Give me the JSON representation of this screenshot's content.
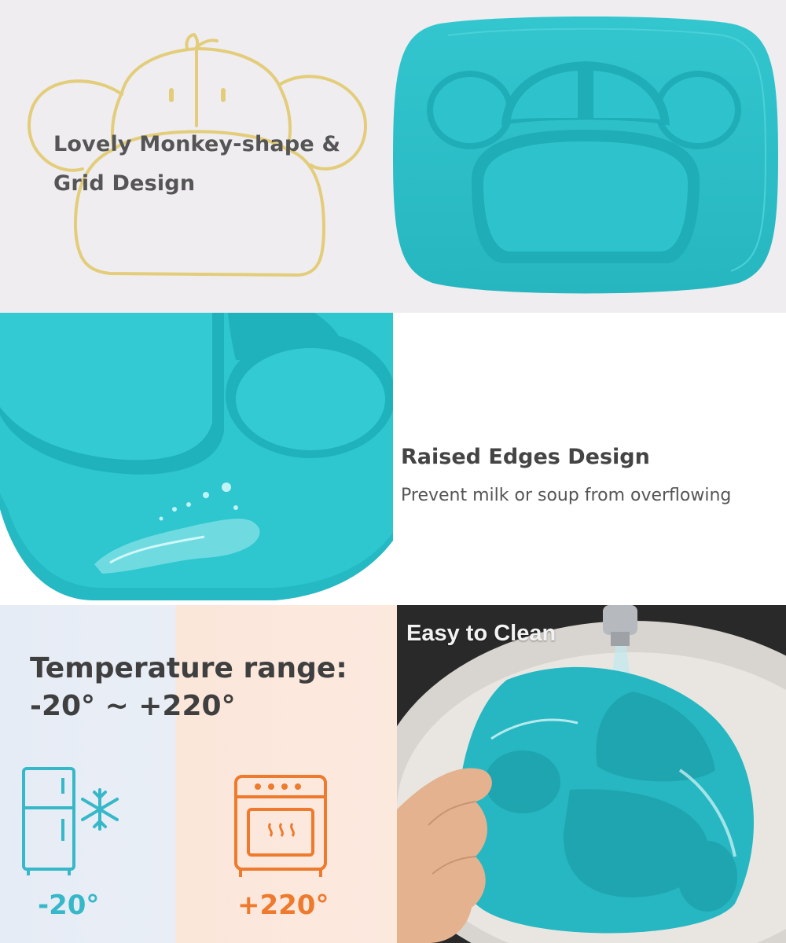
{
  "colors": {
    "plate_teal": "#2ec3cc",
    "outline_yellow": "#e3cd7a",
    "cold_accent": "#37b8c8",
    "hot_accent": "#ee7a2d"
  },
  "design_section": {
    "title_line1": "Lovely Monkey-shape &",
    "title_line2": "Grid Design"
  },
  "edges_section": {
    "title": "Raised Edges Design",
    "subtitle": "Prevent milk or soup from overflowing"
  },
  "temperature_section": {
    "title_line1": "Temperature range:",
    "title_line2": "-20°  ~  +220°",
    "cold_value": "-20°",
    "hot_value": "+220°",
    "cold_icons": [
      "fridge-icon",
      "snowflake-icon"
    ],
    "hot_icons": [
      "oven-icon"
    ]
  },
  "clean_section": {
    "label": "Easy to Clean"
  }
}
